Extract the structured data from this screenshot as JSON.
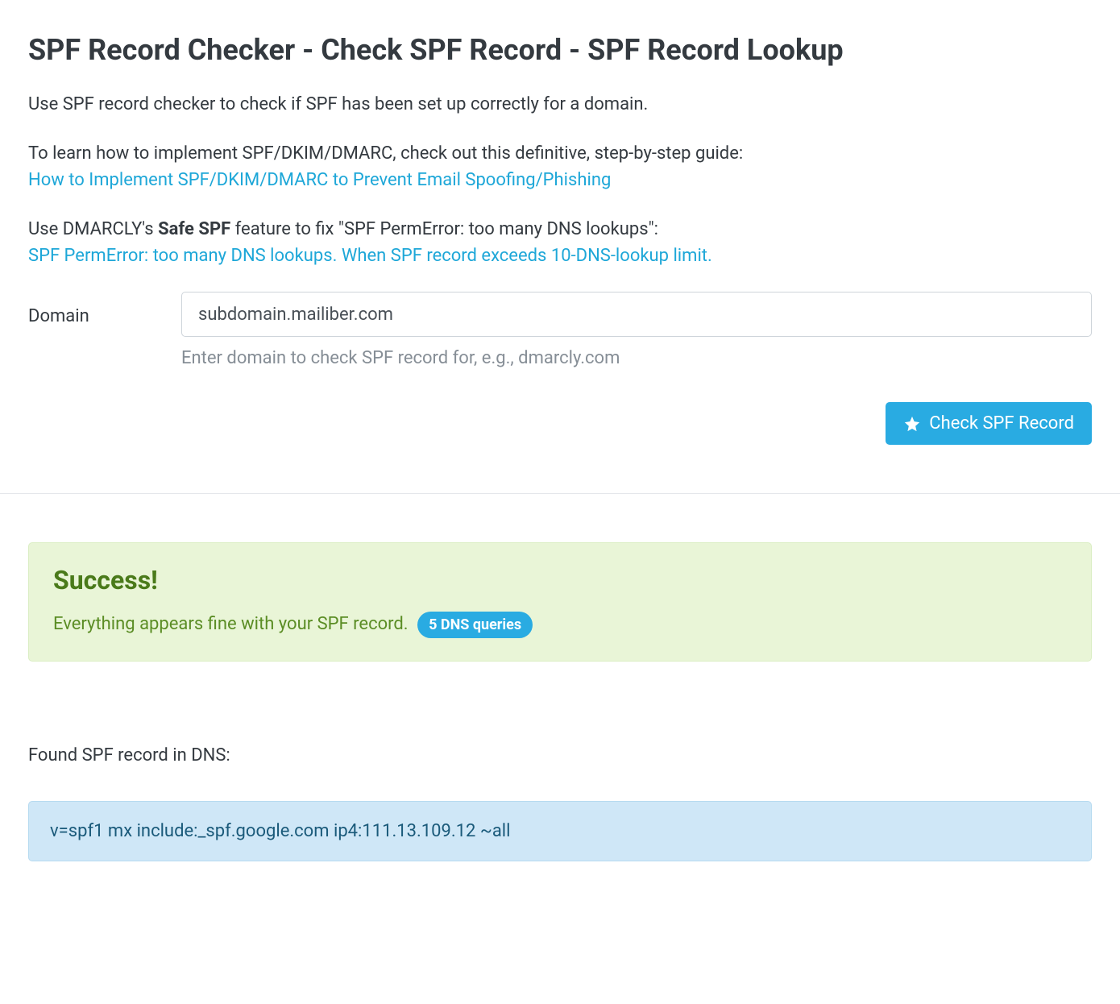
{
  "page": {
    "title": "SPF Record Checker - Check SPF Record - SPF Record Lookup",
    "intro_line1": "Use SPF record checker to check if SPF has been set up correctly for a domain.",
    "intro_line2_prefix": "To learn how to implement SPF/DKIM/DMARC, check out this definitive, step-by-step guide:",
    "intro_link1": "How to Implement SPF/DKIM/DMARC to Prevent Email Spoofing/Phishing",
    "intro_line3_prefix": "Use DMARCLY's ",
    "intro_line3_bold": "Safe SPF",
    "intro_line3_suffix": " feature to fix \"SPF PermError: too many DNS lookups\":",
    "intro_link2": "SPF PermError: too many DNS lookups. When SPF record exceeds 10-DNS-lookup limit."
  },
  "form": {
    "label": "Domain",
    "value": "subdomain.mailiber.com",
    "helper": "Enter domain to check SPF record for, e.g., dmarcly.com",
    "button": "Check SPF Record"
  },
  "result": {
    "success_title": "Success!",
    "success_text": "Everything appears fine with your SPF record.",
    "badge": "5 DNS queries",
    "found_label": "Found SPF record in DNS:",
    "spf_record": "v=spf1 mx include:_spf.google.com ip4:111.13.109.12 ~all"
  }
}
